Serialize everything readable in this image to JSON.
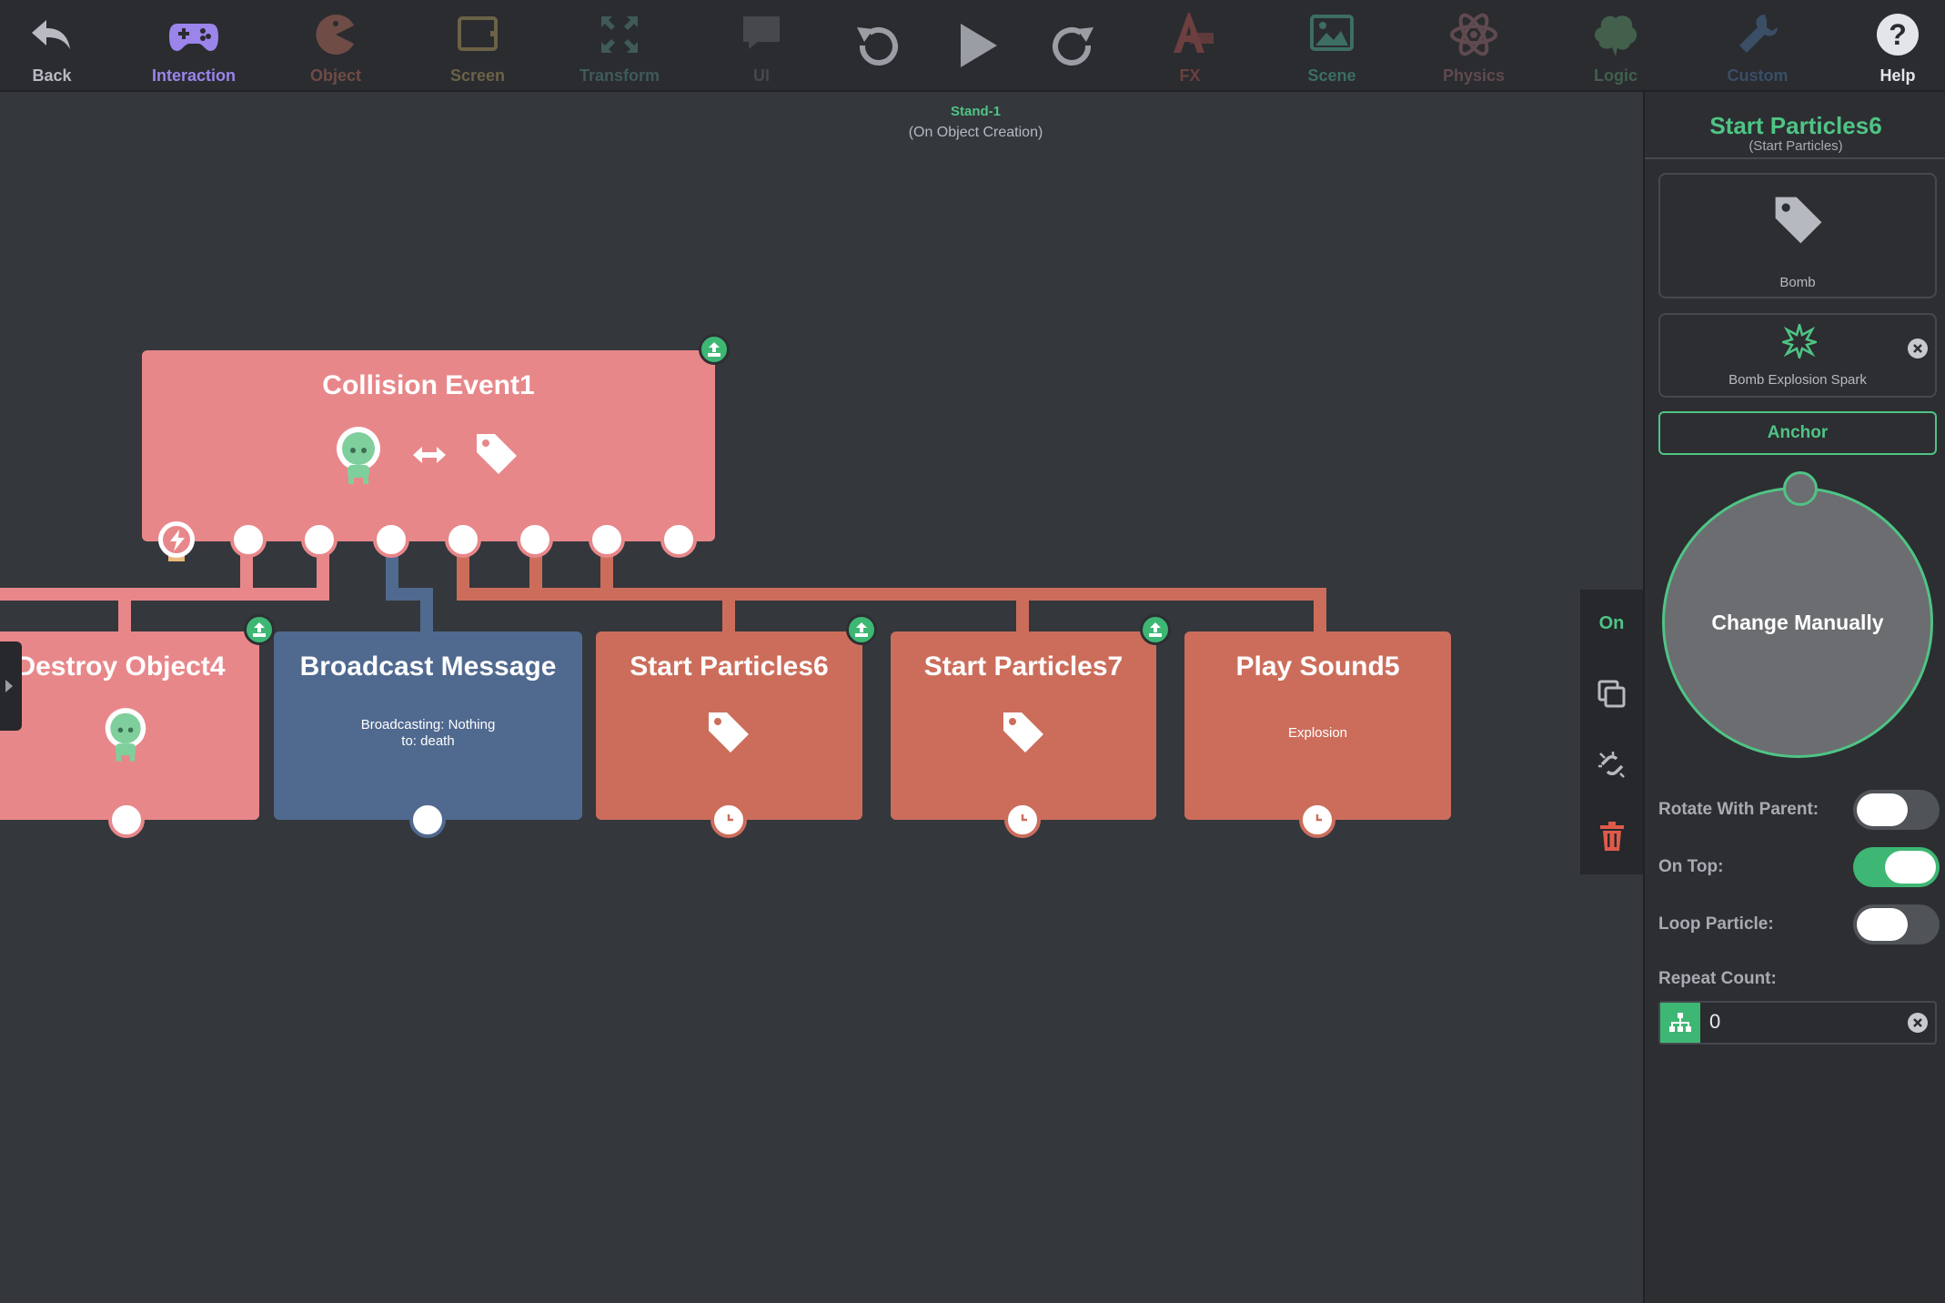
{
  "toolbar": {
    "items": [
      {
        "label": "Back",
        "icon": "back-arrow-icon",
        "color": "#b8bcc2"
      },
      {
        "label": "Interaction",
        "icon": "gamepad-icon",
        "color": "#9b84ea"
      },
      {
        "label": "Object",
        "icon": "pacman-icon",
        "color": "#6f4c46"
      },
      {
        "label": "Screen",
        "icon": "screen-icon",
        "color": "#6b6247"
      },
      {
        "label": "Transform",
        "icon": "transform-icon",
        "color": "#3f5a59"
      },
      {
        "label": "UI",
        "icon": "speech-bubble-icon",
        "color": "#46484c"
      },
      {
        "label": "FX",
        "icon": "fx-icon",
        "color": "#6d3f3f"
      },
      {
        "label": "Scene",
        "icon": "scene-image-icon",
        "color": "#3d6e63"
      },
      {
        "label": "Physics",
        "icon": "atom-icon",
        "color": "#5f4a4f"
      },
      {
        "label": "Logic",
        "icon": "brain-icon",
        "color": "#42604c"
      },
      {
        "label": "Custom",
        "icon": "wrench-icon",
        "color": "#3a4e66"
      },
      {
        "label": "Help",
        "icon": "help-icon",
        "color": "#e3e5e8"
      }
    ],
    "controls": [
      "undo-icon",
      "play-icon",
      "redo-icon"
    ]
  },
  "canvas": {
    "object_name": "Stand-1",
    "trigger": "(On Object Creation)"
  },
  "nodes": {
    "collision": {
      "title": "Collision Event1",
      "color": "#e8878a"
    },
    "destroy": {
      "title": "Destroy Object4",
      "color": "#e8878a"
    },
    "broadcast": {
      "title": "Broadcast Message",
      "line1": "Broadcasting: Nothing",
      "line2": "to: death",
      "color": "#50698f"
    },
    "particles6": {
      "title": "Start Particles6",
      "color": "#cc6d5c"
    },
    "particles7": {
      "title": "Start Particles7",
      "color": "#cc6d5c"
    },
    "sound": {
      "title": "Play Sound5",
      "subtitle": "Explosion",
      "color": "#cc6d5c"
    }
  },
  "side_tools": {
    "on_label": "On",
    "items": [
      "copy-icon",
      "unlink-icon",
      "trash-icon"
    ]
  },
  "panel": {
    "title": "Start Particles6",
    "subtitle": "(Start Particles)",
    "object_label": "Bomb",
    "particle_label": "Bomb Explosion Spark",
    "anchor_label": "Anchor",
    "wheel_label": "Change Manually",
    "props": [
      {
        "label": "Rotate With Parent:",
        "on": false
      },
      {
        "label": "On Top:",
        "on": true
      },
      {
        "label": "Loop Particle:",
        "on": false
      }
    ],
    "repeat_label": "Repeat Count:",
    "repeat_value": "0"
  }
}
